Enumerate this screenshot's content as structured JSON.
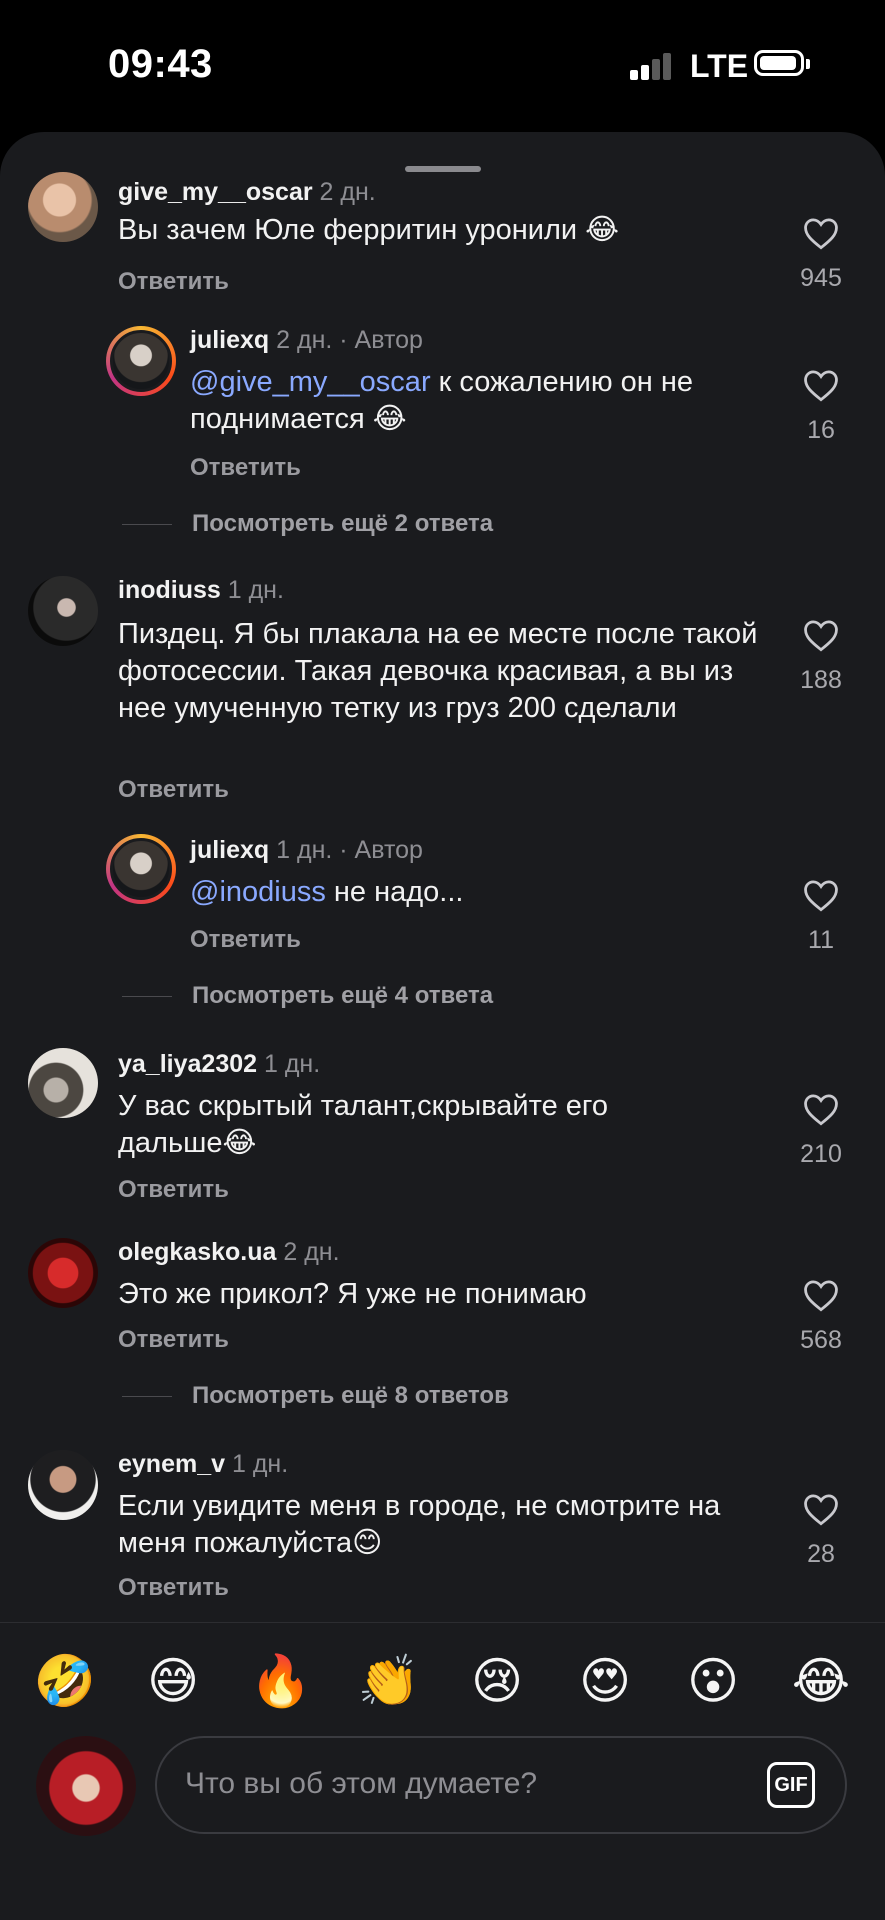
{
  "status": {
    "time": "09:43",
    "network": "LTE"
  },
  "comments": [
    {
      "user": "give_my__oscar",
      "time": "2 дн.",
      "text": "Вы зачем Юле ферритин  уронили 😂",
      "reply": "Ответить",
      "likes": "945"
    },
    {
      "user": "juliexq",
      "time": "2 дн. · Автор",
      "mention": "@give_my__oscar",
      "text_after": " к сожалению он не поднимается 😂",
      "reply": "Ответить",
      "likes": "16"
    },
    {
      "more": "Посмотреть ещё 2 ответа"
    },
    {
      "user": "inodiuss",
      "time": "1 дн.",
      "text": "Пиздец. Я бы плакала на ее месте после такой фотосессии. Такая девочка красивая, а вы из нее умученную тетку из груз 200 сделали",
      "reply": "Ответить",
      "likes": "188"
    },
    {
      "user": "juliexq",
      "time": "1 дн. · Автор",
      "mention": "@inodiuss",
      "text_after": " не надо...",
      "reply": "Ответить",
      "likes": "11"
    },
    {
      "more": "Посмотреть ещё 4 ответа"
    },
    {
      "user": "ya_liya2302",
      "time": "1 дн.",
      "text": "У вас скрытый талант,скрывайте его дальше😂",
      "reply": "Ответить",
      "likes": "210"
    },
    {
      "user": "olegkasko.ua",
      "time": "2 дн.",
      "text": "Это же прикол? Я уже не понимаю",
      "reply": "Ответить",
      "likes": "568"
    },
    {
      "more": "Посмотреть ещё 8 ответов"
    },
    {
      "user": "eynem_v",
      "time": "1 дн.",
      "text": "Если увидите меня в городе, не смотрите на меня пожалуйста😊",
      "reply": "Ответить",
      "likes": "28"
    }
  ],
  "emoji_bar": [
    "🤣",
    "😅",
    "🔥",
    "👏",
    "😢",
    "😍",
    "😮",
    "😂"
  ],
  "composer": {
    "placeholder": "Что вы об этом думаете?",
    "gif": "GIF"
  }
}
